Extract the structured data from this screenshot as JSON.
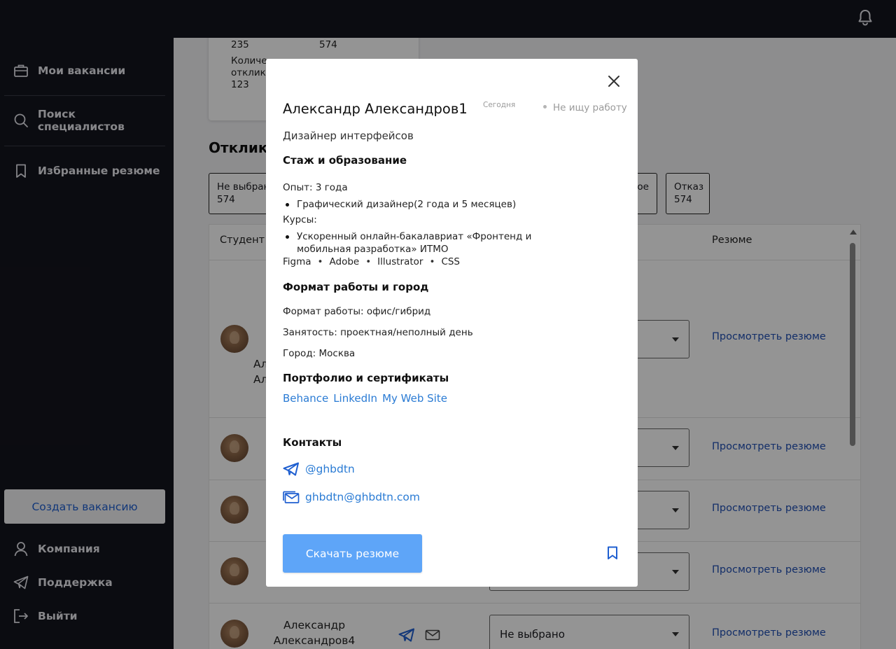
{
  "topbar": {
    "notification_icon": "bell-icon"
  },
  "sidebar": {
    "items": [
      {
        "label": "Мои вакансии",
        "icon": "briefcase-icon"
      },
      {
        "label": "Поиск специалистов",
        "icon": "search-icon"
      },
      {
        "label": "Избранные резюме",
        "icon": "bookmark-icon"
      }
    ],
    "create_button": "Создать вакансию",
    "bottom_items": [
      {
        "label": "Компания",
        "icon": "user-icon"
      },
      {
        "label": "Поддержка",
        "icon": "send-icon"
      },
      {
        "label": "Выйти",
        "icon": "logout-icon"
      }
    ]
  },
  "main": {
    "stat_card": {
      "value_a": "235",
      "value_b": "574",
      "label_line1": "Количе",
      "label_line2": "отклик",
      "value_c": "123"
    },
    "section_title": "Отклики",
    "filters": [
      {
        "label": "Не выбран",
        "count": "574"
      },
      {
        "label": "ое",
        "count": ""
      },
      {
        "label": "Отказ",
        "count": "574"
      }
    ],
    "table": {
      "headers": {
        "student": "Студент",
        "resume": "Резюме"
      },
      "rows": [
        {
          "name_line1": "Ал",
          "name_line2": "Ал",
          "status": "",
          "link": "Просмотреть резюме"
        },
        {
          "status": "",
          "link": "Просмотреть резюме"
        },
        {
          "status": "",
          "link": "Просмотреть резюме"
        },
        {
          "status": "",
          "link": "Просмотреть резюме"
        },
        {
          "name_line1": "Александр",
          "name_line2": "Александров4",
          "status": "Не выбрано",
          "link": "Просмотреть резюме"
        }
      ]
    }
  },
  "modal": {
    "name": "Александр Александров1",
    "date": "Сегодня",
    "status": "Не ищу работу",
    "role": "Дизайнер интерфейсов",
    "experience_heading": "Стаж и образование",
    "experience": "Опыт: 3 года",
    "experience_item": "Графический дизайнер(2 года и 5 месяцев)",
    "courses_label": "Курсы:",
    "course_item": "Ускоренный онлайн-бакалавриат «Фронтенд и мобильная разработка» ИТМО",
    "skills": [
      "Figma",
      "Adobe",
      "Illustrator",
      "CSS"
    ],
    "format_heading": "Формат работы и город",
    "work_format": "Формат работы: офис/гибрид",
    "employment": "Занятость: проектная/неполный день",
    "city": "Город: Москва",
    "portfolio_heading": "Портфолио и сертификаты",
    "portfolio_links": [
      "Behance",
      "LinkedIn",
      "My Web Site"
    ],
    "contacts_heading": "Контакты",
    "telegram": "@ghbdtn",
    "email": "ghbdtn@ghbdtn.com",
    "download_button": "Скачать резюме",
    "accent_color": "#5ea5f8",
    "link_color": "#2a7bd4"
  }
}
